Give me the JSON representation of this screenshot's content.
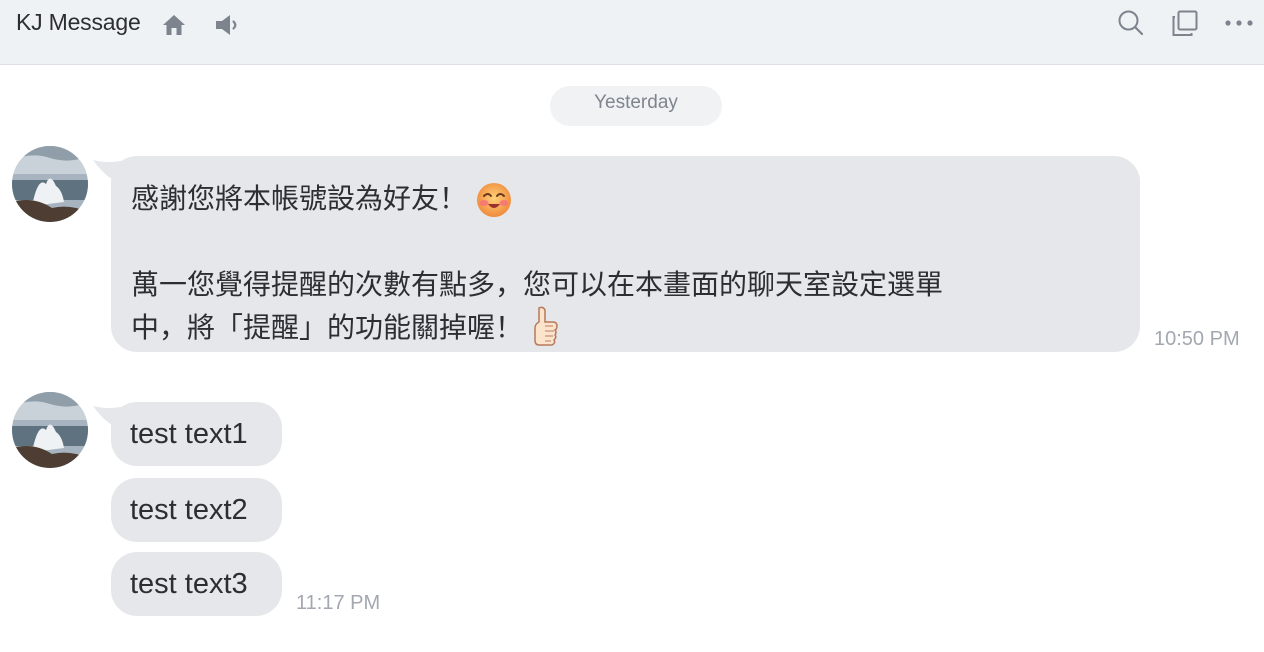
{
  "header": {
    "title": "KJ Message",
    "icons": [
      "home-icon",
      "speaker-icon",
      "search-icon",
      "copy-icon",
      "more-icon"
    ]
  },
  "chat": {
    "date_separator": "Yesterday",
    "message1": {
      "line1": "感謝您將本帳號設為好友！",
      "line2": "萬一您覺得提醒的次數有點多，您可以在本畫面的聊天室設定選單",
      "line3": "中，將「提醒」的功能關掉喔！",
      "time": "10:50 PM"
    },
    "messages": [
      {
        "text": "test text1"
      },
      {
        "text": "test text2"
      },
      {
        "text": "test text3"
      }
    ],
    "group_time": "11:17 PM"
  },
  "colors": {
    "header_bg": "#eff2f5",
    "bubble_bg": "#e5e7ea",
    "timestamp": "#a3a8b0"
  }
}
